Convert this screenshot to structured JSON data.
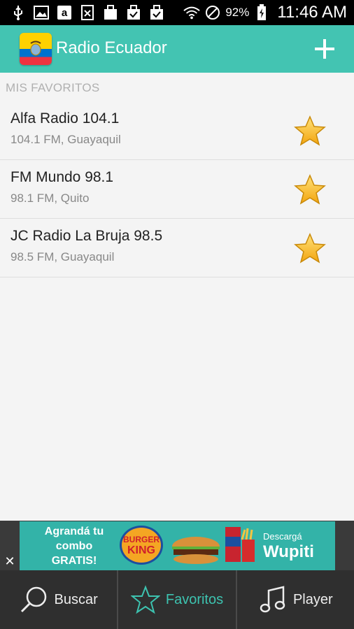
{
  "status_bar": {
    "icons_left": [
      "usb-icon",
      "image-icon",
      "amazon-icon",
      "voicemail-icon",
      "bag-icon",
      "bag-check-icon",
      "bag-check-icon"
    ],
    "battery_pct": "92%",
    "time": "11:46 AM"
  },
  "app_bar": {
    "title": "Radio Ecuador",
    "flag_colors": [
      "#FFD100",
      "#0072CE",
      "#EF3340"
    ],
    "accent": "#43C4B2"
  },
  "favorites": {
    "section_title": "MIS FAVORITOS",
    "items": [
      {
        "name": "Alfa Radio 104.1",
        "details": "104.1 FM, Guayaquil"
      },
      {
        "name": "FM Mundo 98.1",
        "details": "98.1 FM, Quito"
      },
      {
        "name": "JC Radio La Bruja 98.5",
        "details": "98.5 FM, Guayaquil"
      }
    ]
  },
  "ad": {
    "close": "✕",
    "line1": "Agrandá tu",
    "line2": "combo",
    "line3": "GRATIS!",
    "logo_top": "BURGER",
    "logo_bottom": "KING",
    "cta_small": "Descargá",
    "cta_big": "Wupiti"
  },
  "bottom_nav": {
    "search": "Buscar",
    "favorites": "Favoritos",
    "player": "Player",
    "active": "favorites"
  }
}
